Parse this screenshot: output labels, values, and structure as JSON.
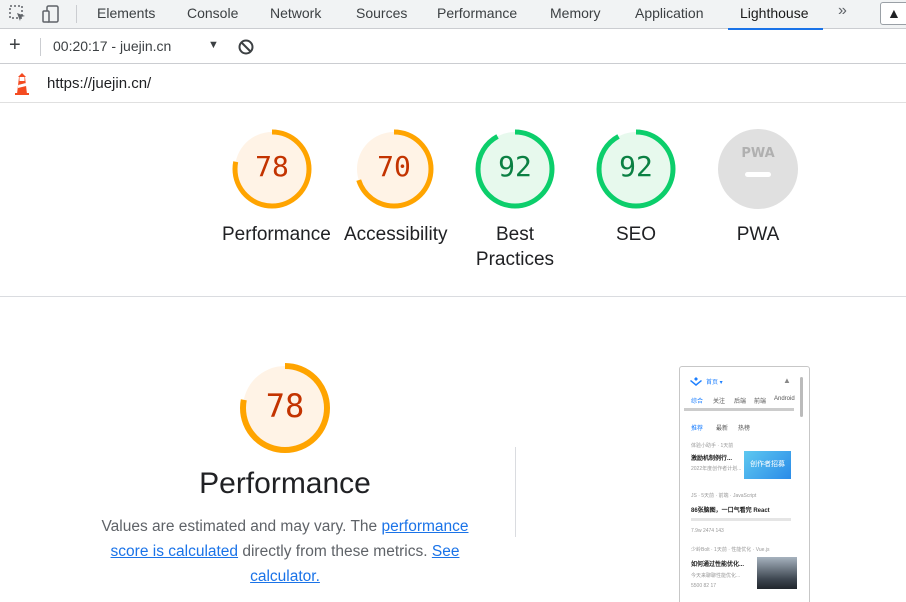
{
  "devtools": {
    "tabs": [
      {
        "label": "Elements"
      },
      {
        "label": "Console"
      },
      {
        "label": "Network"
      },
      {
        "label": "Sources"
      },
      {
        "label": "Performance"
      },
      {
        "label": "Memory"
      },
      {
        "label": "Application"
      },
      {
        "label": "Lighthouse",
        "active": true
      }
    ],
    "more_label": "»",
    "warning_badge": "▲"
  },
  "toolbar": {
    "add_label": "+",
    "report_select": "00:20:17 - juejin.cn"
  },
  "report": {
    "url": "https://juejin.cn/"
  },
  "colors": {
    "average": "#ffa400",
    "average_text": "#c33300",
    "average_fill": "#fff3e6",
    "pass": "#0cce6b",
    "pass_text": "#0b8043",
    "pass_fill": "#e7f9ed",
    "na": "#e0e0e0",
    "link": "#1a73e8"
  },
  "scores": [
    {
      "label": "Performance",
      "value": "78",
      "score": 78,
      "rating": "average"
    },
    {
      "label": "Accessibility",
      "value": "70",
      "score": 70,
      "rating": "average"
    },
    {
      "label": "Best Practices",
      "value": "92",
      "score": 92,
      "rating": "pass"
    },
    {
      "label": "SEO",
      "value": "92",
      "score": 92,
      "rating": "pass"
    },
    {
      "label": "PWA",
      "badge": "PWA",
      "rating": "na"
    }
  ],
  "performance": {
    "score": "78",
    "score_value": 78,
    "title": "Performance",
    "desc_prefix": "Values are estimated and may vary. The ",
    "desc_link1": "performance score is calculated",
    "desc_middle": " directly from these metrics. ",
    "desc_link2": "See calculator."
  },
  "thumbnail": {
    "nav_home": "首页 ▾",
    "tabs": [
      "综合",
      "关注",
      "后端",
      "前端",
      "Android"
    ],
    "subtabs": [
      "推荐",
      "最新",
      "热榜"
    ],
    "items": [
      {
        "meta": "体验小助手 · 1天前",
        "title": "激励机制例行...",
        "excerpt": "2022年度创作者计划...",
        "banner": "创作者招募"
      },
      {
        "meta": "JS · 5天前 · 前端 · JavaScript",
        "title": "86张脑图，一口气看完 React",
        "stats": "7.9w  2474  143"
      },
      {
        "meta": "少岭Bolt · 1天前 · 性能优化 · Vue.js",
        "title": "如何通过性能优化...",
        "excerpt": "今天来聊聊性能优化...",
        "stats": "5500  82  17"
      }
    ]
  }
}
